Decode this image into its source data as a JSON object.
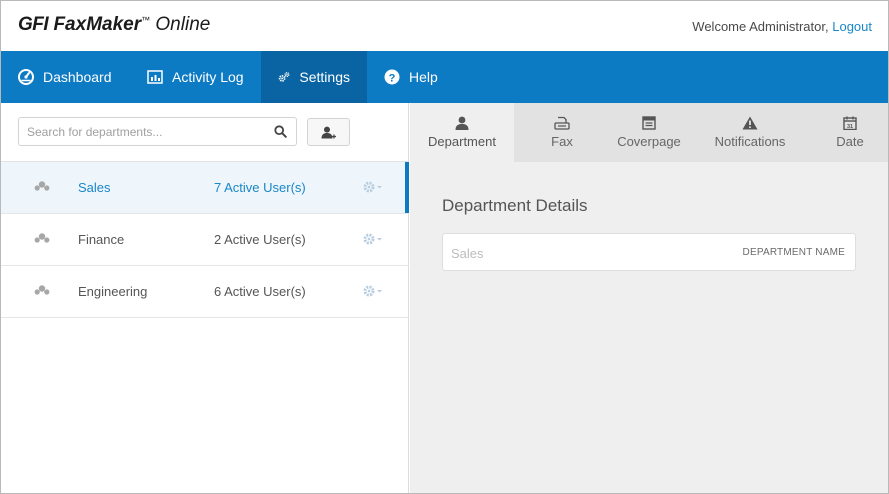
{
  "header": {
    "logo": {
      "gfi": "GFI",
      "faxmaker": "FaxMaker",
      "trademark": "™",
      "online": "Online"
    },
    "welcome_text": "Welcome Administrator,",
    "logout_label": "Logout"
  },
  "nav": {
    "items": [
      {
        "label": "Dashboard",
        "icon": "dashboard-icon"
      },
      {
        "label": "Activity Log",
        "icon": "chart-icon"
      },
      {
        "label": "Settings",
        "icon": "gears-icon",
        "active": true
      },
      {
        "label": "Help",
        "icon": "help-icon"
      }
    ]
  },
  "left": {
    "search": {
      "placeholder": "Search for departments...",
      "value": ""
    },
    "departments": [
      {
        "name": "Sales",
        "users": "7 Active User(s)",
        "selected": true
      },
      {
        "name": "Finance",
        "users": "2 Active User(s)"
      },
      {
        "name": "Engineering",
        "users": "6 Active User(s)"
      }
    ]
  },
  "right": {
    "tabs": [
      {
        "label": "Department",
        "icon": "user-icon",
        "active": true
      },
      {
        "label": "Fax",
        "icon": "fax-icon"
      },
      {
        "label": "Coverpage",
        "icon": "coverpage-icon"
      },
      {
        "label": "Notifications",
        "icon": "warning-icon"
      },
      {
        "label": "Date",
        "icon": "calendar-icon"
      }
    ],
    "details_title": "Department Details",
    "department_name": {
      "value": "Sales",
      "label": "DEPARTMENT NAME"
    }
  },
  "colors": {
    "brand_blue": "#0d7ac4",
    "nav_active": "#0a64a3",
    "link": "#1a86c8"
  }
}
